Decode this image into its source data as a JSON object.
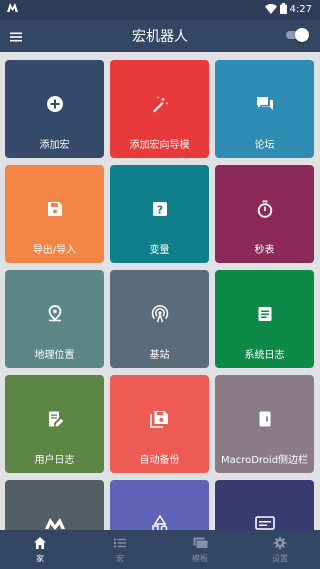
{
  "status_bar": {
    "time": "4:27",
    "app_logo": "macrodroid-m-logo",
    "icons": [
      "wifi-icon",
      "battery-icon"
    ]
  },
  "app_bar": {
    "title": "宏机器人",
    "menu_icon": "hamburger-menu-icon",
    "toggle_state": "on"
  },
  "tiles": [
    {
      "label": "添加宏",
      "icon": "add-circle-icon",
      "color": "#364a6b"
    },
    {
      "label": "添加宏向导模",
      "icon": "magic-wand-icon",
      "color": "#e83a3a"
    },
    {
      "label": "论坛",
      "icon": "forum-icon",
      "color": "#2f8cb5"
    },
    {
      "label": "导出/导入",
      "icon": "save-icon",
      "color": "#f28546"
    },
    {
      "label": "变量",
      "icon": "help-box-icon",
      "color": "#0f7f8c"
    },
    {
      "label": "秒表",
      "icon": "stopwatch-icon",
      "color": "#8b2958"
    },
    {
      "label": "地理位置",
      "icon": "location-pin-icon",
      "color": "#5b8787"
    },
    {
      "label": "基站",
      "icon": "cell-tower-icon",
      "color": "#5a6c7a"
    },
    {
      "label": "系统日志",
      "icon": "log-icon",
      "color": "#0e8a48"
    },
    {
      "label": "用户日志",
      "icon": "edit-log-icon",
      "color": "#5c8546"
    },
    {
      "label": "自动备份",
      "icon": "backup-icon",
      "color": "#ee5a54"
    },
    {
      "label": "MacroDroid侧边栏",
      "icon": "sidebar-icon",
      "color": "#8a7b85"
    },
    {
      "label": "",
      "icon": "macrodroid-logo-icon",
      "color": "#555f66"
    },
    {
      "label": "",
      "icon": "shapes-icon",
      "color": "#5e63b8"
    },
    {
      "label": "",
      "icon": "card-icon",
      "color": "#3b3b72"
    }
  ],
  "bottom_nav": [
    {
      "label": "家",
      "icon": "home-icon",
      "active": true
    },
    {
      "label": "宏",
      "icon": "list-icon",
      "active": false
    },
    {
      "label": "模板",
      "icon": "templates-icon",
      "active": false
    },
    {
      "label": "设置",
      "icon": "gear-icon",
      "active": false
    }
  ]
}
